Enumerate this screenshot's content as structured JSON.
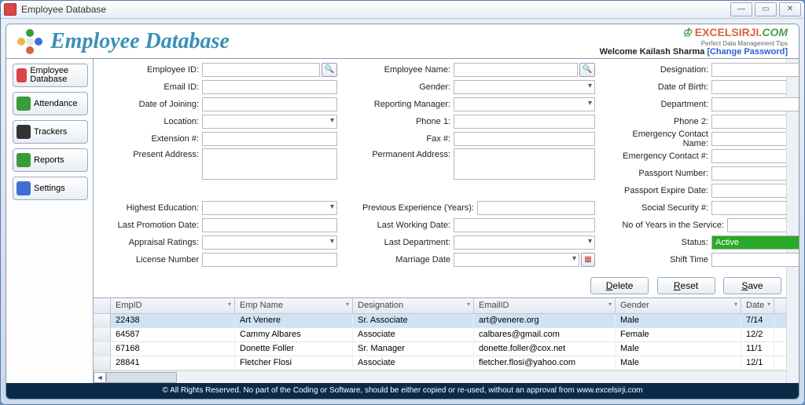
{
  "window": {
    "title": "Employee Database"
  },
  "header": {
    "app_title": "Employee Database",
    "brand_a": "EXCELSIRJI",
    "brand_b": ".COM",
    "brand_sub": "Perfect Data Management Tips",
    "welcome": "Welcome Kailash Sharma ",
    "change_pw": "[Change Password]"
  },
  "sidebar": {
    "items": [
      {
        "label": "Employee Database"
      },
      {
        "label": "Attendance"
      },
      {
        "label": "Trackers"
      },
      {
        "label": "Reports"
      },
      {
        "label": "Settings"
      }
    ]
  },
  "form": {
    "col1": {
      "employee_id": "Employee ID:",
      "email_id": "Email ID:",
      "doj": "Date of Joining:",
      "location": "Location:",
      "extension": "Extension #:",
      "present_addr": "Present Address:",
      "highest_edu": "Highest Education:",
      "last_promo": "Last Promotion Date:",
      "appraisal": "Appraisal Ratings:",
      "license": "License Number"
    },
    "col2": {
      "emp_name": "Employee Name:",
      "gender": "Gender:",
      "rep_mgr": "Reporting Manager:",
      "phone1": "Phone 1:",
      "fax": "Fax #:",
      "perm_addr": "Permanent Address:",
      "prev_exp": "Previous Experience (Years):",
      "lwd": "Last Working Date:",
      "last_dept": "Last Department:",
      "marriage": "Marriage Date"
    },
    "col3": {
      "designation": "Designation:",
      "dob": "Date of Birth:",
      "department": "Department:",
      "phone2": "Phone 2:",
      "econtact_name": "Emergency Contact Name:",
      "econtact_no": "Emergency Contact #:",
      "passport_no": "Passport Number:",
      "passport_exp": "Passport Expire Date:",
      "ssn": "Social Security #:",
      "yos": "No of Years in the Service:",
      "status": "Status:",
      "status_value": "Active",
      "shift": "Shift Time"
    }
  },
  "actions": {
    "delete": {
      "u": "D",
      "rest": "elete"
    },
    "reset": {
      "u": "R",
      "rest": "eset"
    },
    "save": {
      "u": "S",
      "rest": "ave"
    }
  },
  "table": {
    "headers": [
      "EmpID",
      "Emp Name",
      "Designation",
      "EmailID",
      "Gender",
      "Date"
    ],
    "rows": [
      {
        "id": "22438",
        "name": "Art Venere",
        "desg": "Sr. Associate",
        "email": "art@venere.org",
        "gender": "Male",
        "date": "7/14"
      },
      {
        "id": "64587",
        "name": "Cammy Albares",
        "desg": "Associate",
        "email": "calbares@gmail.com",
        "gender": "Female",
        "date": "12/2"
      },
      {
        "id": "67168",
        "name": "Donette Foller",
        "desg": "Sr. Manager",
        "email": "donette.foller@cox.net",
        "gender": "Male",
        "date": "11/1"
      },
      {
        "id": "28841",
        "name": "Fletcher Flosi",
        "desg": "Associate",
        "email": "fletcher.flosi@yahoo.com",
        "gender": "Male",
        "date": "12/1"
      }
    ]
  },
  "footer": "© All Rights Reserved. No part of the Coding or Software, should be either copied or re-used, without an approval from www.excelsirji.com"
}
